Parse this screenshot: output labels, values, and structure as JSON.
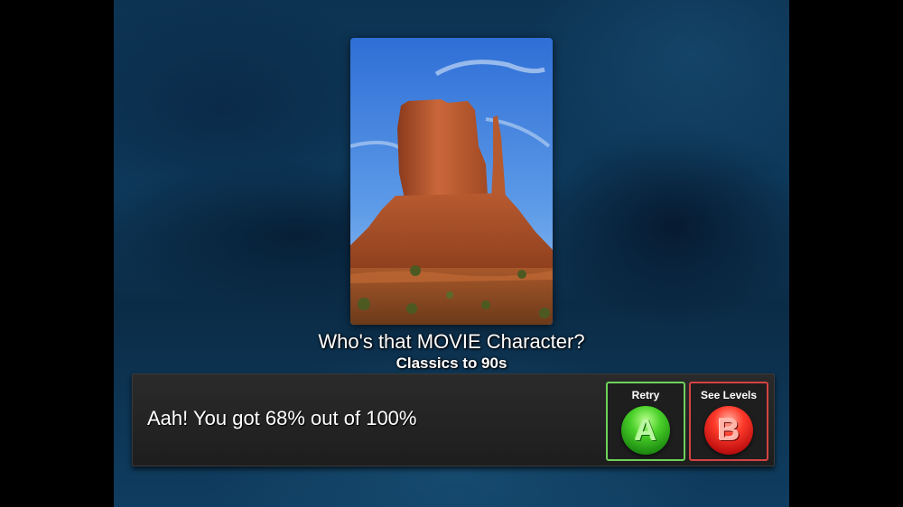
{
  "quiz": {
    "title": "Who's that MOVIE Character?",
    "subtitle": "Classics to 90s"
  },
  "result": {
    "message": "Aah! You got 68% out of 100%"
  },
  "actions": {
    "retry": {
      "label": "Retry",
      "button": "A",
      "color": "#6fd15a"
    },
    "see_levels": {
      "label": "See Levels",
      "button": "B",
      "color": "#d64242"
    }
  },
  "poster": {
    "icon": "desert-butte-image"
  }
}
